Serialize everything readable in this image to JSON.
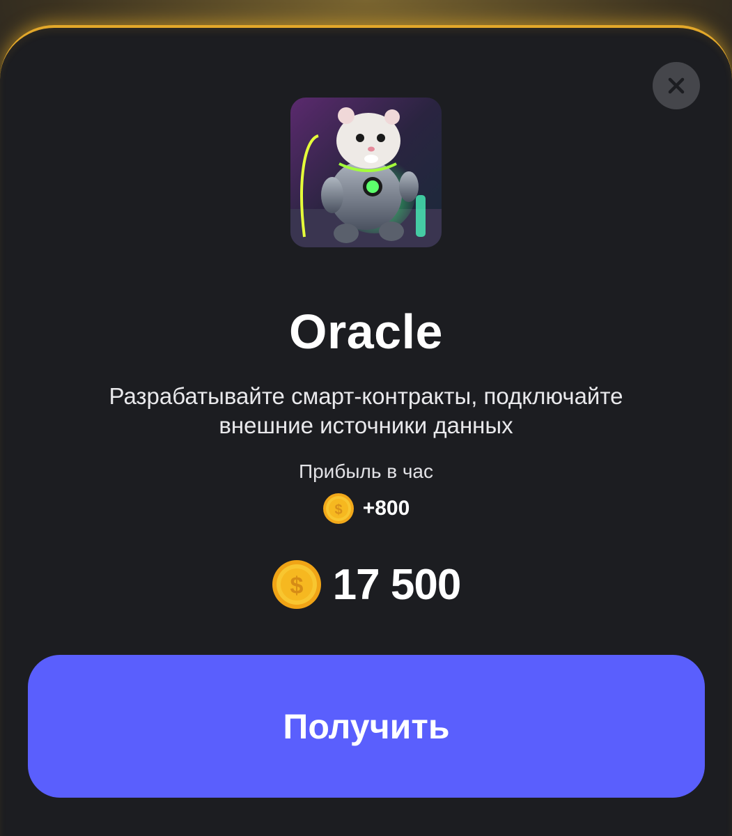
{
  "card": {
    "title": "Oracle",
    "description": "Разрабатывайте смарт-контракты, подключайте внешние источники данных",
    "image_icon": "hamster-robot-image"
  },
  "profit": {
    "label": "Прибыль в час",
    "value": "+800",
    "icon": "coin-icon"
  },
  "price": {
    "value": "17 500",
    "icon": "coin-icon"
  },
  "actions": {
    "get_label": "Получить",
    "close_icon": "close-icon"
  },
  "colors": {
    "sheet_background": "#1c1d21",
    "accent_border": "#e3a82a",
    "button": "#5a5ffd",
    "coin": "#f5c22a"
  }
}
